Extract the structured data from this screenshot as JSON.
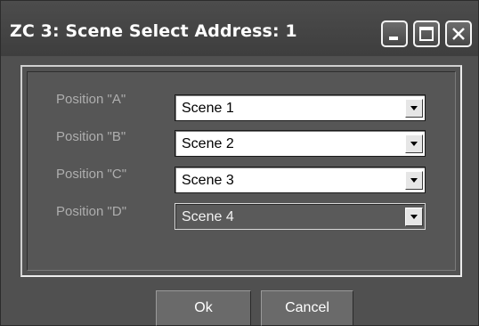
{
  "window": {
    "title": "ZC 3: Scene Select  Address: 1"
  },
  "titlebar_buttons": {
    "minimize_icon": "minimize-icon",
    "maximize_icon": "maximize-icon",
    "close_icon": "close-icon"
  },
  "positions": [
    {
      "label": "Position \"A\"",
      "value": "Scene 1",
      "enabled": true
    },
    {
      "label": "Position \"B\"",
      "value": "Scene 2",
      "enabled": true
    },
    {
      "label": "Position \"C\"",
      "value": "Scene 3",
      "enabled": true
    },
    {
      "label": "Position \"D\"",
      "value": "Scene 4",
      "enabled": false
    }
  ],
  "buttons": {
    "ok_label": "Ok",
    "cancel_label": "Cancel"
  },
  "colors": {
    "window_background": "#505050",
    "label_text": "#aeaeae",
    "button_background": "#6a6a6a"
  }
}
